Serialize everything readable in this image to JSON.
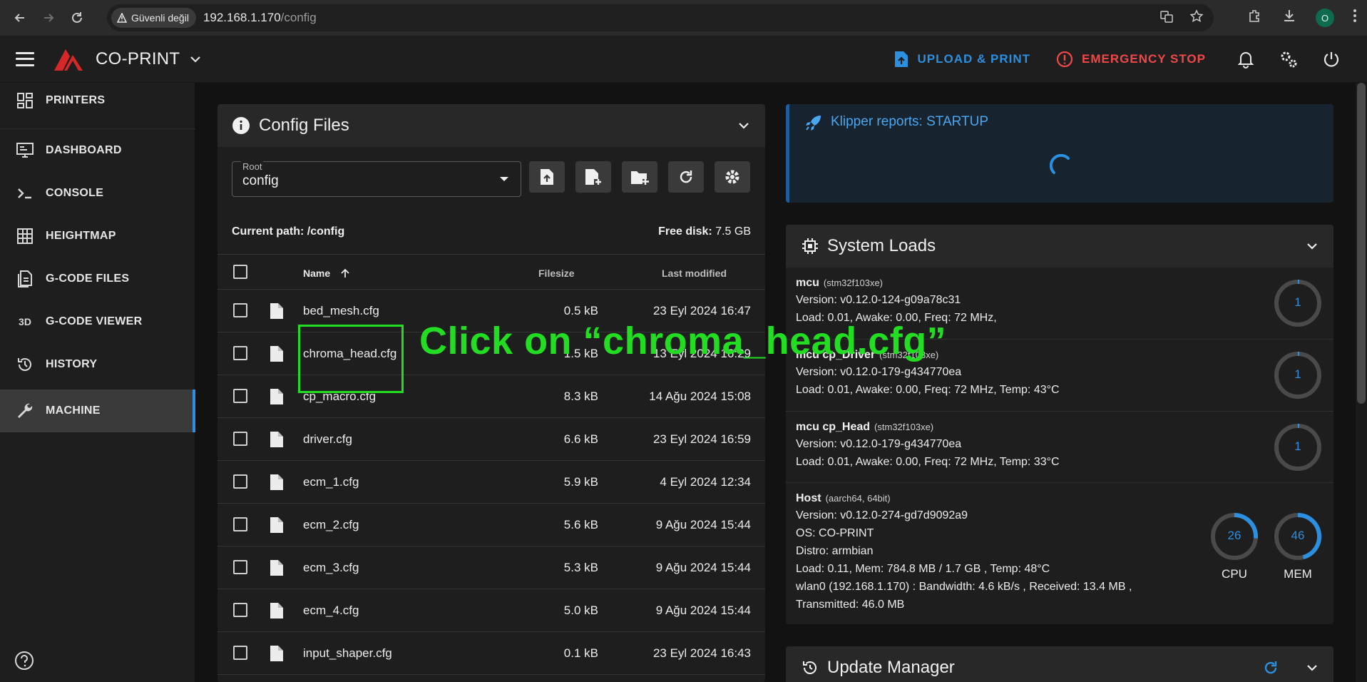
{
  "browser": {
    "security_label": "Güvenli değil",
    "url_host": "192.168.1.170",
    "url_path": "/config",
    "profile_initial": "O"
  },
  "appbar": {
    "brand": "CO-PRINT",
    "upload_label": "UPLOAD & PRINT",
    "estop_label": "EMERGENCY STOP"
  },
  "sidebar": {
    "items": [
      {
        "label": "PRINTERS",
        "icon": "grid-icon"
      },
      {
        "label": "DASHBOARD",
        "icon": "monitor-icon"
      },
      {
        "label": "CONSOLE",
        "icon": "terminal-icon"
      },
      {
        "label": "HEIGHTMAP",
        "icon": "heightmap-icon"
      },
      {
        "label": "G-CODE FILES",
        "icon": "files-icon"
      },
      {
        "label": "G-CODE VIEWER",
        "icon": "3d-icon"
      },
      {
        "label": "HISTORY",
        "icon": "history-icon"
      },
      {
        "label": "MACHINE",
        "icon": "wrench-icon"
      }
    ],
    "viewer_glyph": "3D"
  },
  "config_files": {
    "title": "Config Files",
    "root_label": "Root",
    "root_value": "config",
    "current_path_label": "Current path:",
    "current_path": "/config",
    "free_disk_label": "Free disk:",
    "free_disk": "7.5 GB",
    "columns": {
      "name": "Name",
      "filesize": "Filesize",
      "modified": "Last modified"
    },
    "rows": [
      {
        "name": "bed_mesh.cfg",
        "size": "0.5 kB",
        "modified": "23 Eyl 2024 16:47"
      },
      {
        "name": "chroma_head.cfg",
        "size": "1.5 kB",
        "modified": "13 Eyl 2024 16:29"
      },
      {
        "name": "cp_macro.cfg",
        "size": "8.3 kB",
        "modified": "14 Ağu 2024 15:08"
      },
      {
        "name": "driver.cfg",
        "size": "6.6 kB",
        "modified": "23 Eyl 2024 16:59"
      },
      {
        "name": "ecm_1.cfg",
        "size": "5.9 kB",
        "modified": "4 Eyl 2024 12:34"
      },
      {
        "name": "ecm_2.cfg",
        "size": "5.6 kB",
        "modified": "9 Ağu 2024 15:44"
      },
      {
        "name": "ecm_3.cfg",
        "size": "5.3 kB",
        "modified": "9 Ağu 2024 15:44"
      },
      {
        "name": "ecm_4.cfg",
        "size": "5.0 kB",
        "modified": "9 Ağu 2024 15:44"
      },
      {
        "name": "input_shaper.cfg",
        "size": "0.1 kB",
        "modified": "23 Eyl 2024 16:43"
      }
    ]
  },
  "klipper": {
    "status": "Klipper reports: STARTUP"
  },
  "system_loads": {
    "title": "System Loads",
    "mcus": [
      {
        "name": "mcu",
        "chip": "(stm32f103xe)",
        "version": "Version: v0.12.0-124-g09a78c31",
        "load": "Load: 0.01, Awake: 0.00, Freq: 72 MHz,",
        "gauge": "1"
      },
      {
        "name": "mcu cp_Driver",
        "chip": "(stm32f103xe)",
        "version": "Version: v0.12.0-179-g434770ea",
        "load": "Load: 0.01, Awake: 0.00, Freq: 72 MHz, Temp: 43°C",
        "gauge": "1"
      },
      {
        "name": "mcu cp_Head",
        "chip": "(stm32f103xe)",
        "version": "Version: v0.12.0-179-g434770ea",
        "load": "Load: 0.01, Awake: 0.00, Freq: 72 MHz, Temp: 33°C",
        "gauge": "1"
      }
    ],
    "host": {
      "name": "Host",
      "chip": "(aarch64, 64bit)",
      "version": "Version: v0.12.0-274-gd7d9092a9",
      "os": "OS: CO-PRINT",
      "distro": "Distro: armbian",
      "load": "Load: 0.11, Mem: 784.8 MB / 1.7 GB , Temp: 48°C",
      "network": "wlan0 (192.168.1.170) : Bandwidth: 4.6 kB/s , Received: 13.4 MB ,",
      "transmitted": "Transmitted: 46.0 MB",
      "cpu_value": "26",
      "cpu_label": "CPU",
      "mem_value": "46",
      "mem_label": "MEM"
    }
  },
  "update_manager": {
    "title": "Update Manager"
  },
  "annotation": {
    "text": "Click on “chroma_head.cfg”"
  },
  "colors": {
    "accent": "#2c8fe0",
    "danger": "#f04848",
    "annotation": "#22dd22"
  }
}
